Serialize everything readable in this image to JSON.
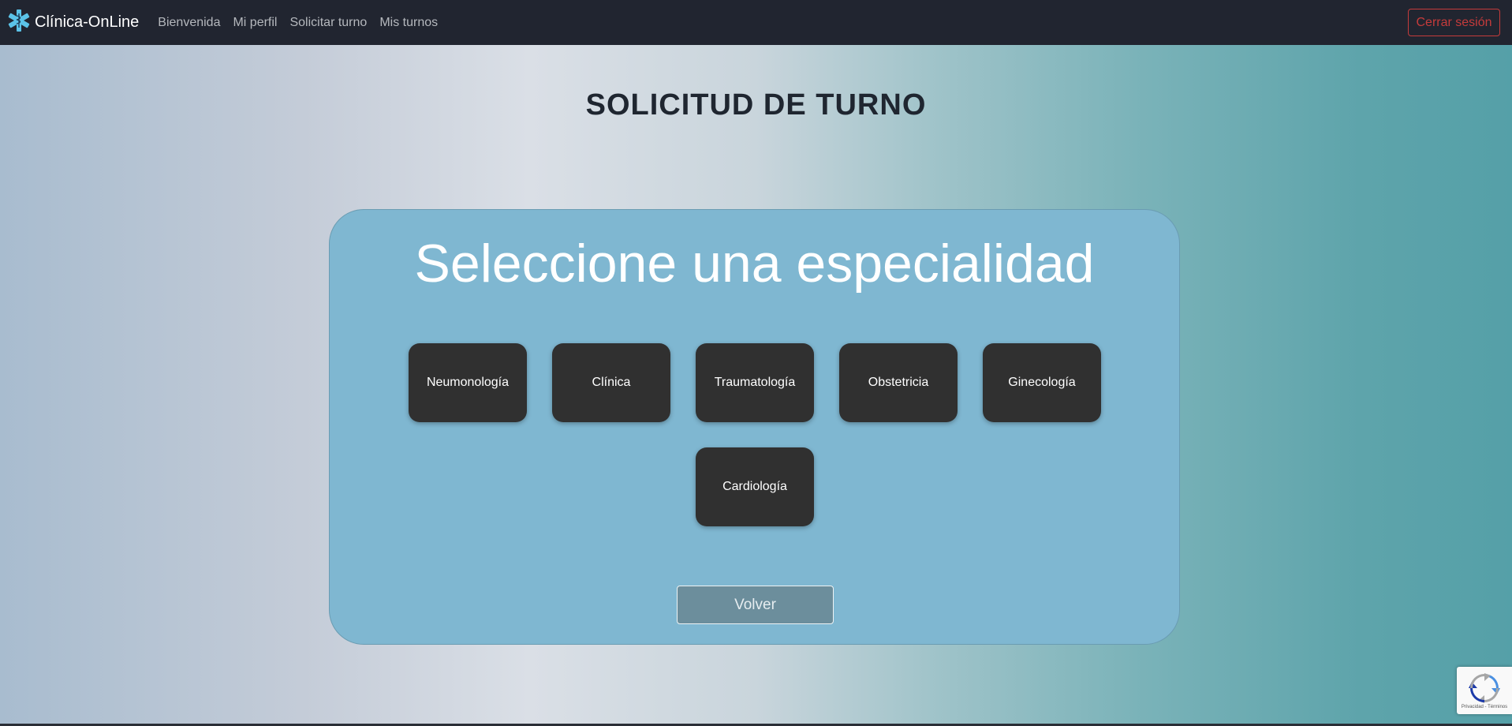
{
  "navbar": {
    "brand_label": "Clínica-OnLine",
    "brand_icon": "medical-star-of-life-icon",
    "links": [
      "Bienvenida",
      "Mi perfil",
      "Solicitar turno",
      "Mis turnos"
    ],
    "logout_label": "Cerrar sesión",
    "logout_color": "#c53b3b",
    "background": "#212530"
  },
  "page": {
    "title": "SOLICITUD DE TURNO"
  },
  "panel": {
    "title": "Seleccione una especialidad",
    "background": "#7fb7d1",
    "specialties": [
      "Neumonología",
      "Clínica",
      "Traumatología",
      "Obstetricia",
      "Ginecología",
      "Cardiología"
    ],
    "back_label": "Volver"
  },
  "recaptcha": {
    "icon": "recaptcha-icon",
    "text": "Privacidad - Términos"
  }
}
